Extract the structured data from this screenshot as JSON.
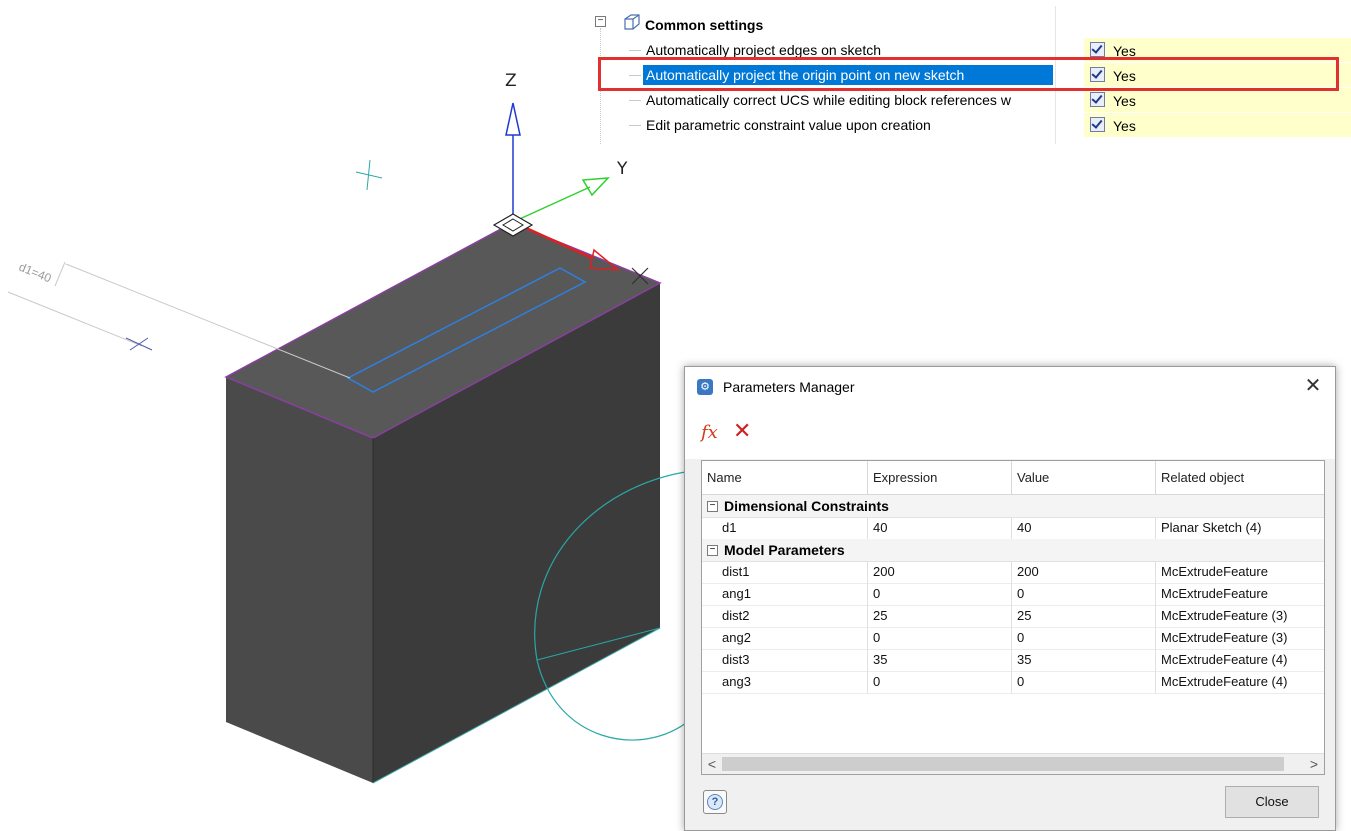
{
  "viewport": {
    "axes": {
      "z": "Z",
      "y": "Y"
    },
    "dimension_label": "d1=40"
  },
  "settings": {
    "group_title": "Common settings",
    "rows": [
      {
        "label": "Automatically project edges on sketch",
        "value": "Yes"
      },
      {
        "label": "Automatically project the origin point on new sketch",
        "value": "Yes"
      },
      {
        "label": "Automatically correct UCS while editing block references w",
        "value": "Yes"
      },
      {
        "label": "Edit parametric constraint value upon creation",
        "value": "Yes"
      }
    ]
  },
  "dialog": {
    "title": "Parameters Manager",
    "close_glyph": "✕",
    "toolbar": {
      "fx": "fx",
      "delete": "✕"
    },
    "columns": [
      "Name",
      "Expression",
      "Value",
      "Related object"
    ],
    "groups": [
      {
        "title": "Dimensional Constraints",
        "rows": [
          [
            "d1",
            "40",
            "40",
            "Planar Sketch (4)"
          ]
        ]
      },
      {
        "title": "Model Parameters",
        "rows": [
          [
            "dist1",
            "200",
            "200",
            "McExtrudeFeature"
          ],
          [
            "ang1",
            "0",
            "0",
            "McExtrudeFeature"
          ],
          [
            "dist2",
            "25",
            "25",
            "McExtrudeFeature (3)"
          ],
          [
            "ang2",
            "0",
            "0",
            "McExtrudeFeature (3)"
          ],
          [
            "dist3",
            "35",
            "35",
            "McExtrudeFeature (4)"
          ],
          [
            "ang3",
            "0",
            "0",
            "McExtrudeFeature (4)"
          ]
        ]
      }
    ],
    "scroll": {
      "left": "<",
      "right": ">"
    },
    "help_label": "?",
    "close_label": "Close"
  }
}
